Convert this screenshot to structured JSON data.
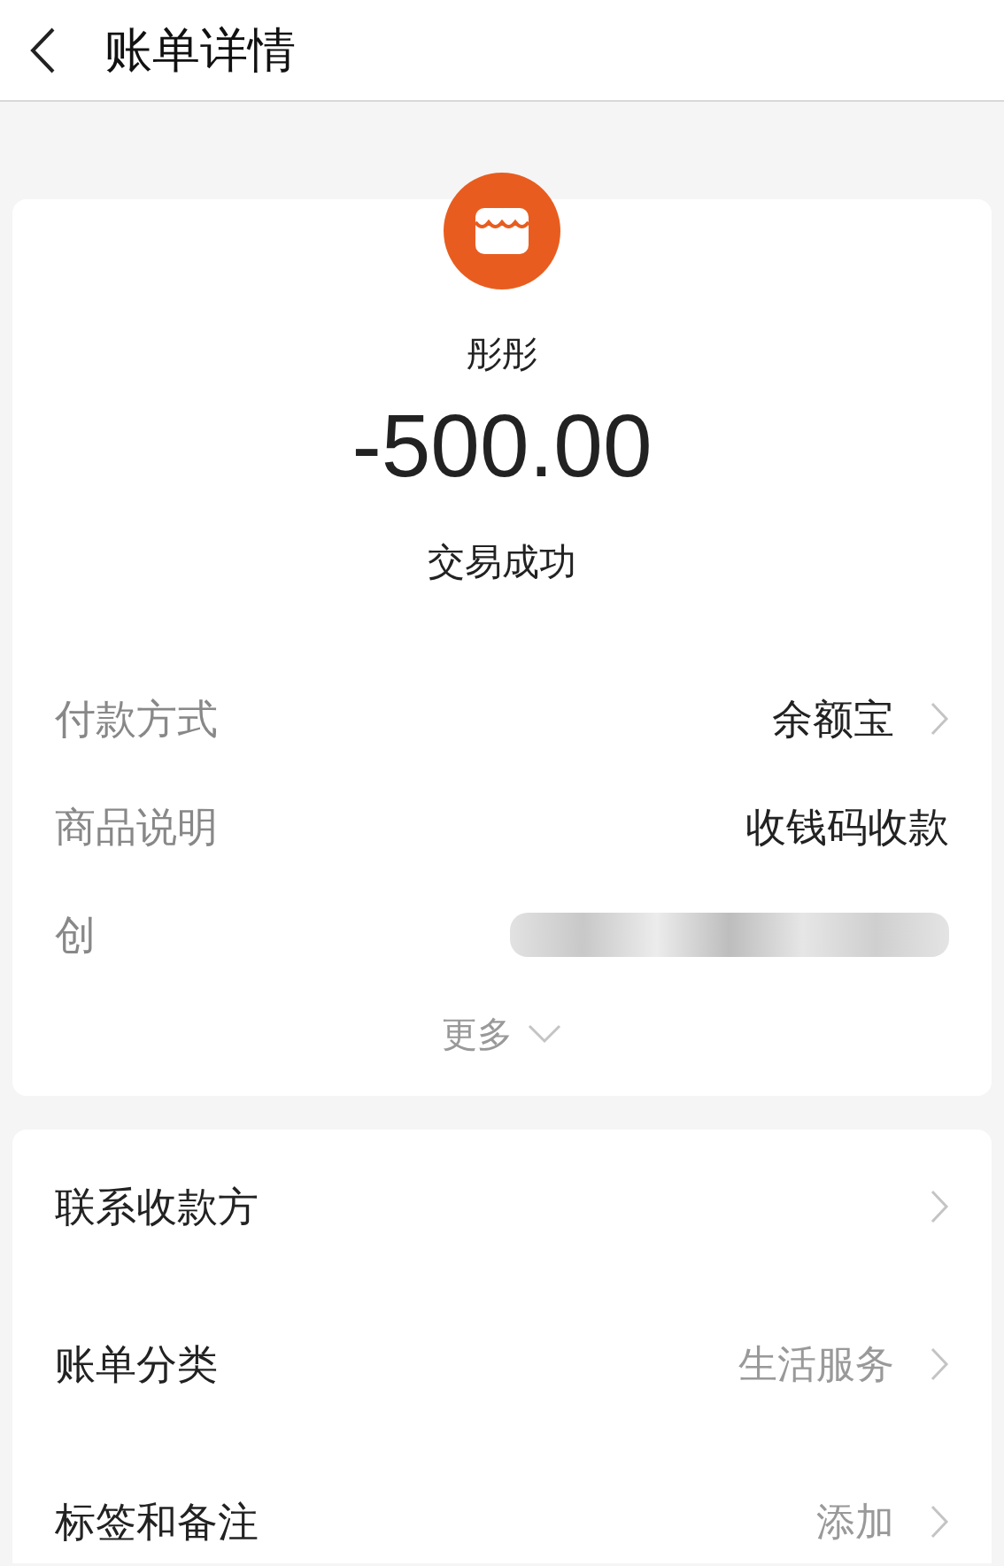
{
  "header": {
    "title": "账单详情"
  },
  "summary": {
    "merchant": "彤彤",
    "amount": "-500.00",
    "status": "交易成功"
  },
  "details": [
    {
      "kind": "link",
      "label": "付款方式",
      "value": "余额宝"
    },
    {
      "kind": "text",
      "label": "商品说明",
      "value": "收钱码收款"
    },
    {
      "kind": "redacted",
      "label": "创"
    }
  ],
  "more": "更多",
  "actions": [
    {
      "label": "联系收款方"
    },
    {
      "label": "账单分类",
      "value": "生活服务"
    },
    {
      "label": "标签和备注",
      "value": "添加"
    }
  ]
}
